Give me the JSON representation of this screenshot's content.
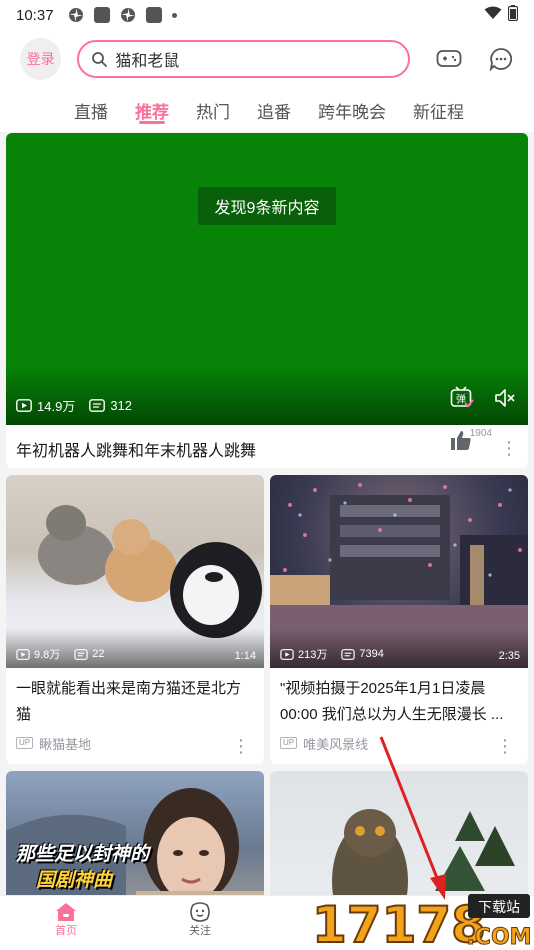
{
  "status_bar": {
    "time": "10:37"
  },
  "header": {
    "login_label": "登录",
    "search_text": "猫和老鼠",
    "icons": [
      "game-controller-icon",
      "chat-bubble-icon"
    ]
  },
  "tabs": [
    {
      "label": "直播",
      "active": false
    },
    {
      "label": "推荐",
      "active": true
    },
    {
      "label": "热门",
      "active": false
    },
    {
      "label": "追番",
      "active": false
    },
    {
      "label": "跨年晚会",
      "active": false
    },
    {
      "label": "新征程",
      "active": false
    }
  ],
  "featured": {
    "notice": "发现9条新内容",
    "plays": "14.9万",
    "danmaku": "312",
    "danmu_icon_text": "弹",
    "title": "年初机器人跳舞和年末机器人跳舞",
    "likes": "1904",
    "video_color": "#078307"
  },
  "cards": [
    {
      "plays": "9.8万",
      "danmaku": "22",
      "duration": "1:14",
      "title": "一眼就能看出来是南方猫还是北方猫",
      "up_badge": "UP",
      "author": "瞅猫基地"
    },
    {
      "plays": "213万",
      "danmaku": "7394",
      "duration": "2:35",
      "title": "\"视频拍摄于2025年1月1日凌晨00:00 我们总以为人生无限漫长 ...",
      "up_badge": "UP",
      "author": "唯美风景线"
    },
    {
      "overlay_text_1": "那些足以封神的",
      "overlay_text_2": "国剧神曲"
    },
    {
      "overlay_text": ""
    }
  ],
  "bottom_nav": [
    {
      "label": "首页",
      "active": true
    },
    {
      "label": "关注",
      "active": false
    }
  ],
  "watermark": {
    "big": "17178",
    "small_1": "下载站",
    "small_2": ".COM"
  },
  "colors": {
    "accent": "#fb7299",
    "text": "#18191c",
    "muted": "#9499a0"
  }
}
